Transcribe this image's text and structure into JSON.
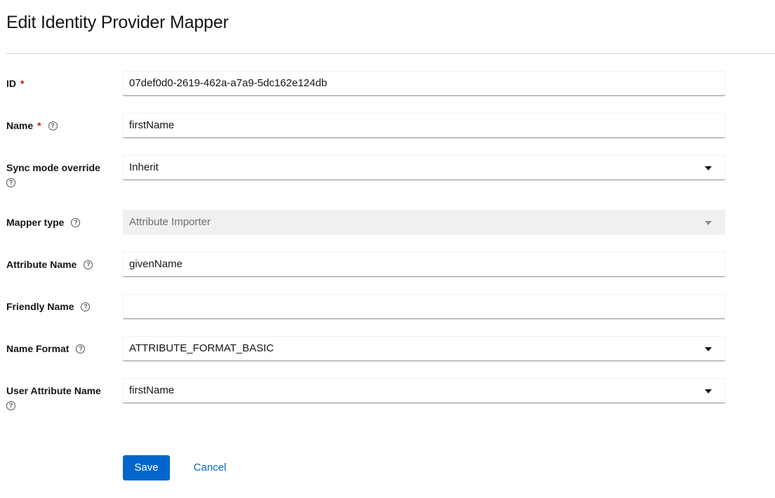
{
  "page": {
    "title": "Edit Identity Provider Mapper"
  },
  "form": {
    "id": {
      "label": "ID",
      "required": "*",
      "value": "07def0d0-2619-462a-a7a9-5dc162e124db"
    },
    "name": {
      "label": "Name",
      "required": "*",
      "value": "firstName"
    },
    "sync_mode": {
      "label": "Sync mode override",
      "value": "Inherit"
    },
    "mapper_type": {
      "label": "Mapper type",
      "value": "Attribute Importer"
    },
    "attribute_name": {
      "label": "Attribute Name",
      "value": "givenName"
    },
    "friendly_name": {
      "label": "Friendly Name",
      "value": ""
    },
    "name_format": {
      "label": "Name Format",
      "value": "ATTRIBUTE_FORMAT_BASIC"
    },
    "user_attribute_name": {
      "label": "User Attribute Name",
      "value": "firstName"
    }
  },
  "actions": {
    "save_label": "Save",
    "cancel_label": "Cancel"
  },
  "icons": {
    "help": "question-circle-icon",
    "dropdown": "caret-down-icon"
  },
  "colors": {
    "primary": "#0066cc",
    "required": "#c9190b",
    "disabled_bg": "#f0f0f0"
  }
}
